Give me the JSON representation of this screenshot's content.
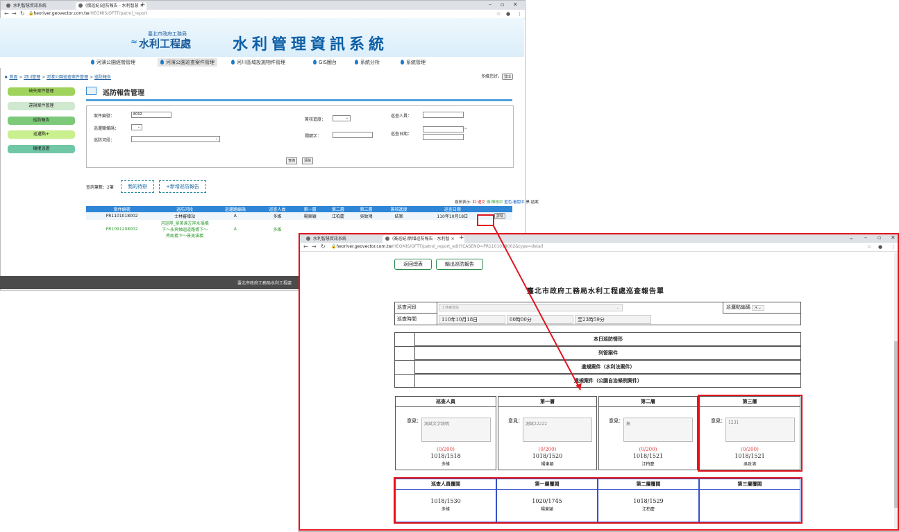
{
  "win1": {
    "tabs": [
      "水利智慧資訊系統",
      "(撰巡紀)巡防報告 - 水利智慧 ×"
    ],
    "url_host": "heoriver.geovector.com.tw",
    "url_path": "/HEOMIS/OFTT/patrol_report",
    "org_name": "臺北市政府工務局",
    "dept_name": "水利工程處",
    "system_title": "水利管理資訊系統",
    "menu": [
      "河濱公園經營管理",
      "河濱公園巡查案件管理",
      "河川區域設施物件管理",
      "GIS圖台",
      "系統分析",
      "系統管理"
    ],
    "breadcrumb": [
      "首頁",
      "河川管理",
      "河濱公園巡查案件管理",
      "巡防報告"
    ],
    "greeting": "多維您好，",
    "logout": "登出",
    "sidebar": [
      "缺失案件管理",
      "違規案件管理",
      "巡防報告",
      "巡邏點+",
      "機權憑證"
    ],
    "page_title": "巡防報告管理",
    "filter": {
      "case_no_label": "案件編號：",
      "case_no_value": "8002",
      "route_no_label": "巡邏職備碼：",
      "river_label": "巡防河段：",
      "status_label": "簽核進度：",
      "keyword_label": "關鍵字：",
      "patroller_label": "巡查人員：",
      "date_label": "巡查日期：",
      "date_sep": "~",
      "search_btn": "查詢",
      "clear_btn": "清除"
    },
    "count_text": "查詢筆數：2筆",
    "my_pending": "我的待辦",
    "add_report": "+新增巡防報告",
    "legend": [
      {
        "text": "簽核表示: ",
        "color": "#333333"
      },
      {
        "text": "紅:退文",
        "color": "#e01010"
      },
      {
        "text": " 綠:陳核中",
        "color": "#2e9a2e"
      },
      {
        "text": " 藍色:審閱中",
        "color": "#1060d0"
      },
      {
        "text": " 黑:結案",
        "color": "#333333"
      }
    ],
    "table_headers": [
      "案件編號",
      "巡防河段",
      "巡邏路編碼",
      "巡查人員",
      "第一層",
      "第二層",
      "第三層",
      "簽核進度",
      "巡查日期",
      ""
    ],
    "rows": [
      {
        "case": "PR1101018002",
        "river": "士林審增站",
        "route": "A",
        "person": "多維",
        "l1": "楊東穎",
        "l2": "江柏慶",
        "l3": "吳致鴻",
        "status": "結案",
        "date": "110年10月18日",
        "action": "詳情"
      },
      {
        "case": "PR1091208002",
        "river": "河巡隊_景美溪左岸永福橋下～永興抽迴道路橋下～秀朗橋下～景美溪橋",
        "route": "A",
        "person": "多維",
        "l1": "",
        "l2": "",
        "l3": "",
        "status": "",
        "date": "",
        "action": ""
      }
    ],
    "footer": "臺北市政府工務局水利工程處"
  },
  "win2": {
    "tabs": [
      "水利智慧資訊系統",
      "(簽巡紀)新增巡防報告 - 水利智 ×"
    ],
    "url_host": "heoriver.geovector.com.tw",
    "url_path": "/HEOMIS/OFTT/patrol_report_edit?CASENO=PR1101018002&type=detail",
    "back_btn": "返回總表",
    "export_btn": "輸出巡防報告",
    "doc_title": "臺北市政府工務局水利工程處巡查報告單",
    "river_label": "巡查河段",
    "river_value": "士林審增站",
    "route_label": "巡邏點編碼",
    "route_value": "A",
    "time_label": "巡查時間",
    "time_date": "110年10月18日",
    "time_start": "00時00分",
    "time_end": "至23時59分",
    "sections": [
      "本日巡防情形",
      "列管案件",
      "違規案件（水利法案件）",
      "違規案件（公園自治條例案件）"
    ],
    "panels": [
      {
        "title": "巡查人員",
        "opinion_label": "意見：",
        "opinion": "測試文字說明",
        "count": "(0/200)",
        "datetime": "1018/1518",
        "name": "多維"
      },
      {
        "title": "第一層",
        "opinion_label": "意見：",
        "opinion": "測試22222",
        "count": "(0/200)",
        "datetime": "1018/1520",
        "name": "楊東穎"
      },
      {
        "title": "第二層",
        "opinion_label": "意見：",
        "opinion": "無",
        "count": "(0/200)",
        "datetime": "1018/1521",
        "name": "江柏慶"
      },
      {
        "title": "第三層",
        "opinion_label": "意見：",
        "opinion": "1231",
        "count": "(0/200)",
        "datetime": "1018/1521",
        "name": "吳致鴻"
      }
    ],
    "review": [
      {
        "title": "巡查人員覆閱",
        "datetime": "1018/1530",
        "name": "多維"
      },
      {
        "title": "第一層覆閱",
        "datetime": "1020/1745",
        "name": "楊東穎"
      },
      {
        "title": "第二層覆閱",
        "datetime": "1018/1529",
        "name": "江柏慶"
      },
      {
        "title": "第三層覆閱",
        "datetime": "",
        "name": ""
      }
    ]
  },
  "colors": {
    "highlight": "#e0141e",
    "accent": "#2f86d6",
    "sidebar_green": "#7cc97a",
    "review_border": "#3450c8"
  }
}
